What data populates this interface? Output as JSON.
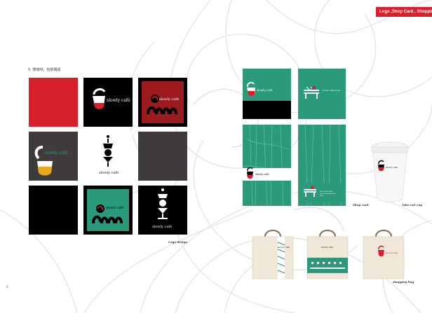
{
  "header": {
    "tag_label": "Logo ,Shop Card , Shopping Bag"
  },
  "section": {
    "title": "5. 慢咖啡，包裝構成"
  },
  "logos": {
    "brand_a": "slowly  café",
    "brand_b": "slowly  café",
    "brand_c": "slowly  café",
    "brand_d": "slowly  café",
    "brand_e": "slowly  café",
    "caption": "Logo  design"
  },
  "cards": {
    "front_brand": "slowly  café",
    "back_brand": "slowly  coffee & tea",
    "back_line1": "0000-0000-0000",
    "back_line2": "xxx road xxx district",
    "back_line3": "xxxx",
    "caption": "Shop  card"
  },
  "cup": {
    "caption": "Take-out cup"
  },
  "bags": {
    "bag1_brand": "slowly  café",
    "bag2_brand": "slowly  café",
    "bag3_brand": "slowly  café",
    "caption": "shopping  bag"
  },
  "page": {
    "number": "8"
  },
  "colors": {
    "red": "#d7202b",
    "black": "#000000",
    "green": "#2a9a7b",
    "gray": "#3f3b3b",
    "darkred": "#9b1b1f",
    "tag": "#d7202b"
  }
}
